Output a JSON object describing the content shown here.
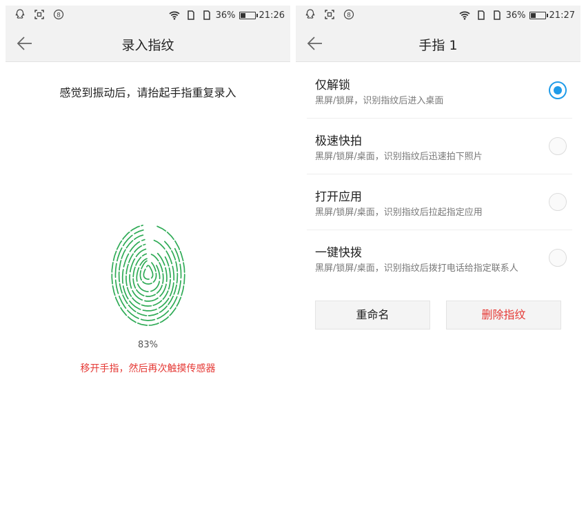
{
  "left": {
    "statusbar": {
      "battery_percent": "36%",
      "time": "21:26",
      "battery_level": 0.36
    },
    "appbar": {
      "title": "录入指纹"
    },
    "instruction": "感觉到振动后，请抬起手指重复录入",
    "progress": {
      "text": "83%",
      "value": 0.83
    },
    "hint": "移开手指，然后再次触摸传感器",
    "colors": {
      "fingerprint": "#2eaa55",
      "hint": "#e53935"
    }
  },
  "right": {
    "statusbar": {
      "battery_percent": "36%",
      "time": "21:27",
      "battery_level": 0.36
    },
    "appbar": {
      "title": "手指 1"
    },
    "options": [
      {
        "title": "仅解锁",
        "desc": "黑屏/锁屏，识别指纹后进入桌面",
        "selected": true
      },
      {
        "title": "极速快拍",
        "desc": "黑屏/锁屏/桌面，识别指纹后迅速拍下照片",
        "selected": false
      },
      {
        "title": "打开应用",
        "desc": "黑屏/锁屏/桌面，识别指纹后拉起指定应用",
        "selected": false
      },
      {
        "title": "一键快拨",
        "desc": "黑屏/锁屏/桌面，识别指纹后拨打电话给指定联系人",
        "selected": false
      }
    ],
    "buttons": {
      "rename": "重命名",
      "delete": "删除指纹"
    },
    "colors": {
      "accent": "#1e9be9",
      "delete": "#e53935"
    }
  },
  "icons": {
    "statusbar_left": [
      "qq-icon",
      "screenshot-icon",
      "notification-badge-icon"
    ],
    "statusbar_right": [
      "wifi-icon",
      "sim1-icon",
      "sim2-icon",
      "battery-icon"
    ],
    "appbar": "back-arrow-icon",
    "fingerprint": "fingerprint-icon"
  }
}
